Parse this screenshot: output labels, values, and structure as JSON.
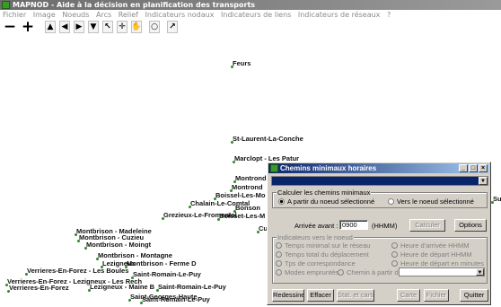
{
  "window": {
    "title": "MAPNOD - Aide à la décision en planification des transports"
  },
  "menu": [
    "Fichier",
    "Image",
    "Noeuds",
    "Arcs",
    "Relief",
    "Indicateurs nodaux",
    "Indicateurs de liens",
    "Indicateurs de réseaux",
    "?"
  ],
  "toolbar": {
    "zoom_out": "−",
    "zoom_in": "+",
    "tools": [
      "▲",
      "◀",
      "▶",
      "▼",
      "↖",
      "✛",
      "✋",
      "○",
      "↗"
    ]
  },
  "map_nodes": [
    "Feurs",
    "St-Laurent-La-Conche",
    "Marclopt - Les Patur",
    "Montrond",
    "Montrond",
    "Boissel-Les-Mo",
    "Chalain-Le-Comtal",
    "Bonson",
    "Grezieux-Le-Fromental",
    "Boisset-Les-M",
    "Montbrison - Madeleine",
    "Montbrison - Cuzieu",
    "Montbrison - Moingt",
    "Montbrison - Montagne",
    "Montbrison - Ferme D",
    "Lezigneux",
    "Verrieres-En-Forez - Les Boules",
    "Verrieres-En-Forez - Lezigneux - Les Rech",
    "Verrieres-En-Forez",
    "Lezigneux - Maine B",
    "Saint-Romain-Le-Puy",
    "Saint-Romain-Le-Puy",
    "Saint-Georges-Haute",
    "Saint-Romain-Le-Puy",
    "Cu",
    "Su"
  ],
  "dialog": {
    "title": "Chemins minimaux horaires",
    "btn_minimize": "_",
    "btn_maximize": "□",
    "btn_close": "×",
    "calc_group": "Calculer les chemins minimaux",
    "radio_from": "A partir du noeud sélectionné",
    "radio_to": "Vers le noeud sélectionné",
    "arrival_label": "Arrivée avant :",
    "arrival_value": "0900",
    "arrival_unit": "(HHMM)",
    "calc_button": "Calculer",
    "options_button": "Options",
    "indicators_group": "Indicateurs vers le noeud",
    "ind_min_time": "Temps minimal sur le réseau",
    "ind_total_time": "Temps total du déplacement",
    "ind_correspondance": "Tps de correspondance",
    "ind_modes": "Modes empruntés",
    "ind_path_from": "Chemin à partir de",
    "ind_arrival_hour": "Heure d'arrivée HHMM",
    "ind_departure_hour": "Heure de départ HHMM",
    "ind_departure_min": "Heure de départ en minutes",
    "btn_redessiner": "Redessiner",
    "btn_effacer": "Effacer",
    "btn_stat": "Stat. et carto",
    "btn_carte": "Carte",
    "btn_fichier": "Fichier",
    "btn_quitter": "Quitter"
  }
}
